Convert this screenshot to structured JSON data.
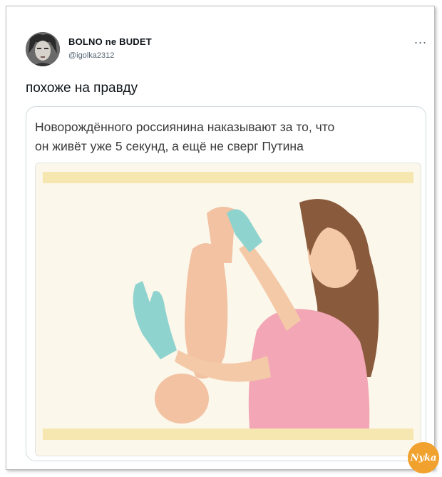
{
  "tweet": {
    "display_name": "BOLNO ne BUDET",
    "handle": "@igolka2312",
    "more_label": "...",
    "text": "похоже на правду"
  },
  "quote": {
    "line1": "Новорождённого россиянина наказывают за то, что",
    "line2": "он живёт уже 5 секунд, а ещё не сверг Путина"
  },
  "watermark": {
    "text": "Nyka"
  },
  "colors": {
    "skin": "#f4c9a8",
    "glove": "#8fd3cf",
    "shirt": "#f3a6b6",
    "hair": "#8a5a3c",
    "illustration_bg": "#fbf7ea",
    "band": "#f6e7b0"
  }
}
